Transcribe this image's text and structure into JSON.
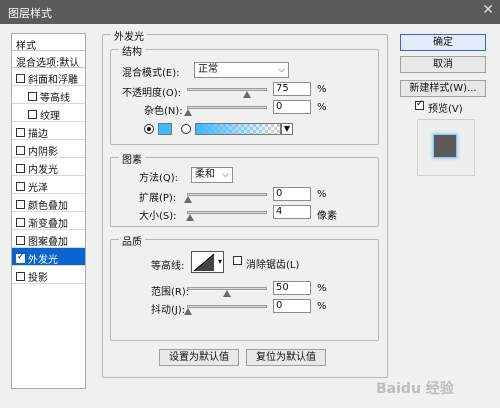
{
  "window": {
    "title": "图层样式",
    "close_glyph": "✕"
  },
  "style_list": {
    "header": "样式",
    "blend_options": "混合选项:默认",
    "items": [
      {
        "label": "斜面和浮雕",
        "checked": false,
        "sub": false,
        "selected": false
      },
      {
        "label": "等高线",
        "checked": false,
        "sub": true,
        "selected": false
      },
      {
        "label": "纹理",
        "checked": false,
        "sub": true,
        "selected": false
      },
      {
        "label": "描边",
        "checked": false,
        "sub": false,
        "selected": false
      },
      {
        "label": "内阴影",
        "checked": false,
        "sub": false,
        "selected": false
      },
      {
        "label": "内发光",
        "checked": false,
        "sub": false,
        "selected": false
      },
      {
        "label": "光泽",
        "checked": false,
        "sub": false,
        "selected": false
      },
      {
        "label": "颜色叠加",
        "checked": false,
        "sub": false,
        "selected": false
      },
      {
        "label": "渐变叠加",
        "checked": false,
        "sub": false,
        "selected": false
      },
      {
        "label": "图案叠加",
        "checked": false,
        "sub": false,
        "selected": false
      },
      {
        "label": "外发光",
        "checked": true,
        "sub": false,
        "selected": true
      },
      {
        "label": "投影",
        "checked": false,
        "sub": false,
        "selected": false
      }
    ]
  },
  "outer_glow": {
    "section_title": "外发光",
    "structure": {
      "title": "结构",
      "blend_mode_label": "混合模式(E):",
      "blend_mode_value": "正常",
      "opacity_label": "不透明度(O):",
      "opacity_value": "75",
      "opacity_fraction": 0.75,
      "noise_label": "杂色(N):",
      "noise_value": "0",
      "noise_fraction": 0,
      "percent": "%",
      "color_hex": "#3cbcff"
    },
    "elements": {
      "title": "图素",
      "technique_label": "方法(Q):",
      "technique_value": "柔和",
      "spread_label": "扩展(P):",
      "spread_value": "0",
      "spread_fraction": 0,
      "size_label": "大小(S):",
      "size_value": "4",
      "size_fraction": 0.02,
      "percent": "%",
      "pixels": "像素"
    },
    "quality": {
      "title": "品质",
      "contour_label": "等高线:",
      "anti_alias_label": "消除锯齿(L)",
      "range_label": "范围(R):",
      "range_value": "50",
      "range_fraction": 0.5,
      "jitter_label": "抖动(J):",
      "jitter_value": "0",
      "jitter_fraction": 0,
      "percent": "%"
    },
    "make_default": "设置为默认值",
    "reset_default": "复位为默认值"
  },
  "buttons": {
    "ok": "确定",
    "cancel": "取消",
    "new_style": "新建样式(W)...",
    "preview_label": "预览(V)",
    "preview_checked": true
  },
  "watermark": "Baidu 经验"
}
